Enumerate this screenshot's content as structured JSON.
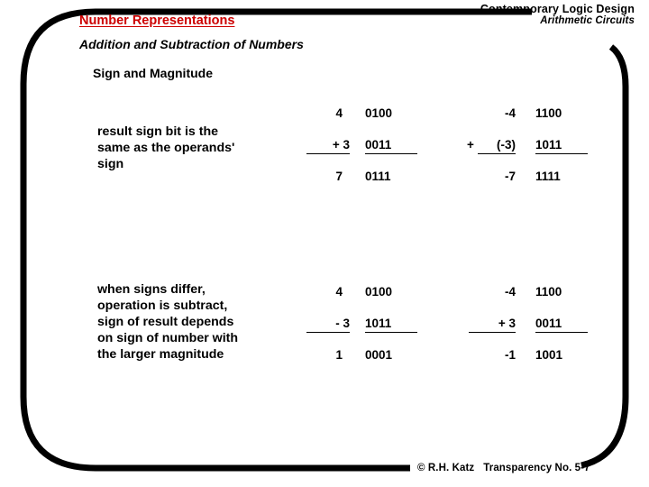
{
  "header": {
    "course": "Contemporary Logic Design",
    "chapter": "Arithmetic Circuits"
  },
  "title": {
    "main": "Number Representations",
    "sub": "Addition and Subtraction of Numbers",
    "sub2": "Sign and Magnitude"
  },
  "blocks": [
    {
      "description": "result sign bit is the\nsame as the operands'\nsign",
      "left_example": {
        "rows": [
          {
            "decimal": "4",
            "binary": "0100",
            "underline": false
          },
          {
            "decimal": "+ 3",
            "binary": "0011",
            "underline": true
          },
          {
            "decimal": "7",
            "binary": "0111",
            "underline": false
          }
        ]
      },
      "right_example": {
        "rows": [
          {
            "decimal": "-4",
            "operator": "",
            "operand": "-4",
            "binary": "1100",
            "underline": false
          },
          {
            "decimal": "+ (-3)",
            "operator": "+",
            "operand": "(-3)",
            "binary": "1011",
            "underline": true
          },
          {
            "decimal": "-7",
            "operator": "",
            "operand": "-7",
            "binary": "1111",
            "underline": false
          }
        ]
      }
    },
    {
      "description": "when signs differ,\noperation is subtract,\nsign of result depends\non sign of number with\nthe larger magnitude",
      "left_example": {
        "rows": [
          {
            "decimal": "4",
            "binary": "0100",
            "underline": false
          },
          {
            "decimal": "- 3",
            "binary": "1011",
            "underline": true
          },
          {
            "decimal": "1",
            "binary": "0001",
            "underline": false
          }
        ]
      },
      "right_example": {
        "rows": [
          {
            "decimal": "-4",
            "operator": "",
            "operand": "-4",
            "binary": "1100",
            "underline": false
          },
          {
            "decimal": "+ 3",
            "operator": "",
            "operand": "+ 3",
            "binary": "0011",
            "underline": true
          },
          {
            "decimal": "-1",
            "operator": "",
            "operand": "-1",
            "binary": "1001",
            "underline": false
          }
        ]
      }
    }
  ],
  "footer": {
    "copyright": "© R.H. Katz",
    "transparency": "Transparency No. 5-7"
  },
  "colors": {
    "title_red": "#CC0000",
    "frame_black": "#000000",
    "background": "#FFFFFF"
  }
}
